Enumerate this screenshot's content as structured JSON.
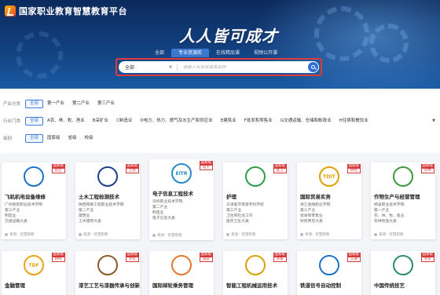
{
  "header": {
    "brand": "国家职业教育智慧教育平台",
    "slogan": "人人皆可成才",
    "tabs": [
      {
        "label": "全部",
        "active": false
      },
      {
        "label": "专业资源库",
        "active": true
      },
      {
        "label": "在线精品课",
        "active": false
      },
      {
        "label": "视频公开课",
        "active": false
      }
    ]
  },
  "search": {
    "scope": "全部",
    "placeholder": "请输入专业资源库名称"
  },
  "filters": {
    "industry": {
      "label": "产业分类",
      "options": [
        "全部",
        "第一产业",
        "第二产业",
        "第三产业"
      ],
      "selected": "全部"
    },
    "sector": {
      "label": "行业门类",
      "options": [
        "全部",
        "A农、林、牧、渔业",
        "B采矿业",
        "C制造业",
        "D电力、热力、燃气及水生产和供应业",
        "E建筑业",
        "F批发和零售业",
        "G交通运输、仓储和邮政业",
        "H住宿和餐饮业"
      ],
      "selected": "全部"
    },
    "level": {
      "label": "级别",
      "options": [
        "全部",
        "国家级",
        "省级",
        "校级"
      ],
      "selected": "全部"
    }
  },
  "cards": [
    {
      "title": "飞机机电设备维修",
      "tag_top": "国家级",
      "tag_bottom": "航空",
      "meta": [
        "广州民航职业技术学院",
        "第三产业",
        "制造业",
        "交通运输大类"
      ],
      "source": "来源：智慧职教",
      "accent": "#1e73c8"
    },
    {
      "title": "土木工程检测技术",
      "tag_top": "国家级",
      "tag_bottom": "土建",
      "meta": [
        "陕西铁路工程职业技术学院",
        "第二产业",
        "建筑业",
        "土木建筑大类"
      ],
      "source": "来源：智慧职教",
      "accent": "#1d3f8a"
    },
    {
      "title": "电子信息工程技术",
      "tag_top": "国家级",
      "tag_bottom": "电子",
      "meta": [
        "深圳职业技术学院",
        "第二产业",
        "制造业",
        "电子信息大类"
      ],
      "source": "来源：智慧职教",
      "accent": "#2a8ac8",
      "logo_text": "EITR"
    },
    {
      "title": "护理",
      "tag_top": "国家级",
      "tag_bottom": "医卫",
      "meta": [
        "天津医学高等专科学校",
        "第三产业",
        "卫生和社会工作",
        "医药卫生大类"
      ],
      "source": "来源：智慧职教",
      "accent": "#2f9e44"
    },
    {
      "title": "国际贸易实务",
      "tag_top": "国家级",
      "tag_bottom": "财经",
      "meta": [
        "浙江金融职业学院",
        "第三产业",
        "批发和零售业",
        "财经商贸大类"
      ],
      "source": "来源：智慧职教",
      "accent": "#e0a100",
      "logo_text": "TDIT"
    },
    {
      "title": "作物生产与经营管理",
      "tag_top": "国家级",
      "tag_bottom": "农林",
      "meta": [
        "杨凌职业技术学院",
        "第一产业",
        "农、林、牧、渔业",
        "农林牧渔大类"
      ],
      "source": "来源：智慧职教",
      "accent": "#3c9a3c"
    },
    {
      "title": "金融管理",
      "tag_top": "国家级",
      "tag_bottom": "财经",
      "meta": [],
      "source": "",
      "accent": "#e8a317",
      "logo_text": "TDF"
    },
    {
      "title": "漆艺工艺与漆器传承与创新",
      "tag_top": "国家级",
      "tag_bottom": "文化",
      "meta": [],
      "source": "",
      "accent": "#8a5a2b"
    },
    {
      "title": "国际邮轮乘务管理",
      "tag_top": "国家级",
      "tag_bottom": "旅游",
      "meta": [],
      "source": "",
      "accent": "#e07a2a"
    },
    {
      "title": "智能工程机械运用技术",
      "tag_top": "国家级",
      "tag_bottom": "装备",
      "meta": [],
      "source": "",
      "accent": "#d9a300"
    },
    {
      "title": "铁道信号自动控制",
      "tag_top": "国家级",
      "tag_bottom": "交通",
      "meta": [],
      "source": "",
      "accent": "#1e73c8"
    },
    {
      "title": "中国传统技艺",
      "tag_top": "国家级",
      "tag_bottom": "文化",
      "meta": [],
      "source": "",
      "accent": "#2a8c6a"
    }
  ]
}
